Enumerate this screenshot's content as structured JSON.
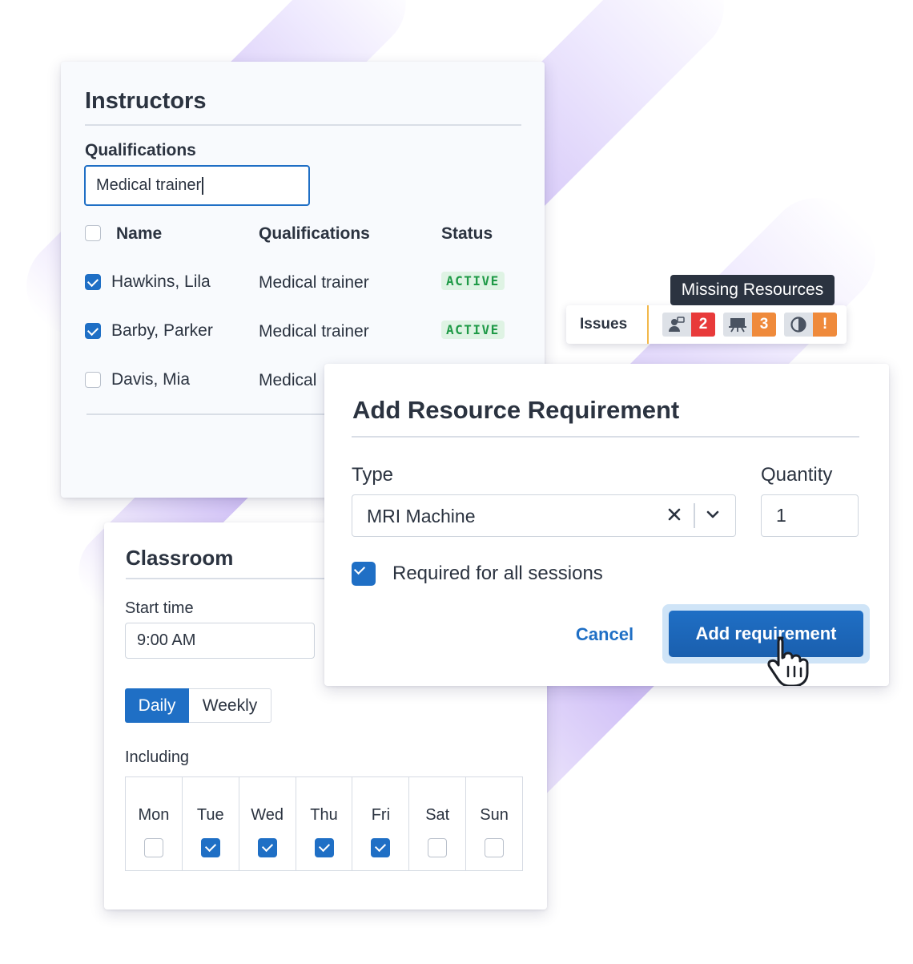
{
  "instructors": {
    "title": "Instructors",
    "filter_label": "Qualifications",
    "filter_value": "Medical trainer",
    "columns": {
      "name": "Name",
      "qualifications": "Qualifications",
      "status": "Status"
    },
    "rows": [
      {
        "name": "Hawkins, Lila",
        "qualification": "Medical trainer",
        "status": "ACTIVE",
        "checked": true
      },
      {
        "name": "Barby, Parker",
        "qualification": "Medical trainer",
        "status": "ACTIVE",
        "checked": true
      },
      {
        "name": "Davis, Mia",
        "qualification": "Medical",
        "status": "",
        "checked": false
      }
    ]
  },
  "issues": {
    "label": "Issues",
    "tooltip": "Missing Resources",
    "items": [
      {
        "icon": "instructor-icon",
        "count": "2",
        "color": "#e83a3a"
      },
      {
        "icon": "classroom-icon",
        "count": "3",
        "color": "#ef8a3b"
      },
      {
        "icon": "contrast-icon",
        "count": "!",
        "color": "#ef8a3b"
      }
    ]
  },
  "dialog": {
    "title": "Add Resource Requirement",
    "type_label": "Type",
    "type_value": "MRI Machine",
    "quantity_label": "Quantity",
    "quantity_value": "1",
    "required_label": "Required for all sessions",
    "required_checked": true,
    "cancel_label": "Cancel",
    "add_label": "Add requirement"
  },
  "classroom": {
    "title": "Classroom",
    "start_label": "Start time",
    "start_value": "9:00 AM",
    "frequency": {
      "daily": "Daily",
      "weekly": "Weekly",
      "selected": "Daily"
    },
    "including_label": "Including",
    "days": [
      {
        "name": "Mon",
        "checked": false
      },
      {
        "name": "Tue",
        "checked": true
      },
      {
        "name": "Wed",
        "checked": true
      },
      {
        "name": "Thu",
        "checked": true
      },
      {
        "name": "Fri",
        "checked": true
      },
      {
        "name": "Sat",
        "checked": false
      },
      {
        "name": "Sun",
        "checked": false
      }
    ]
  },
  "colors": {
    "accent": "#1f6fc5",
    "active_green": "#1f9a47",
    "text": "#2b3340"
  }
}
